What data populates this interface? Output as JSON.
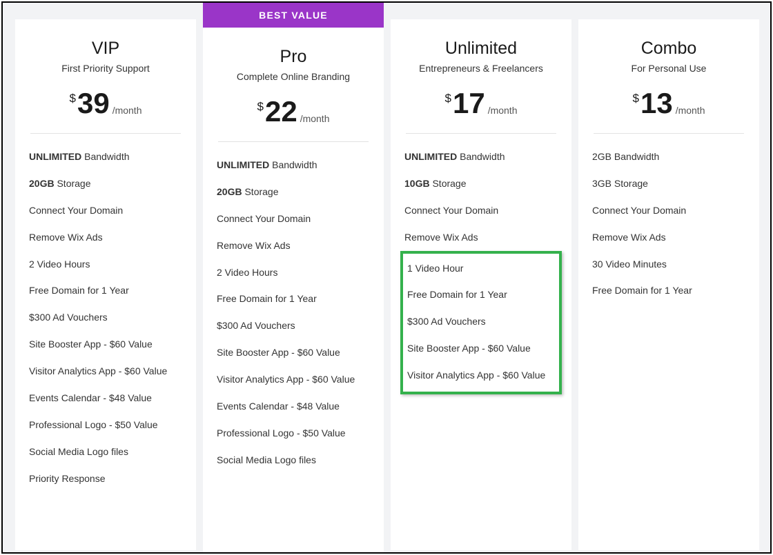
{
  "best_value_label": "BEST VALUE",
  "currency_symbol": "$",
  "period_label": "/month",
  "plans": [
    {
      "title": "VIP",
      "subtitle": "First Priority Support",
      "price": "39",
      "features": [
        {
          "prefix": "UNLIMITED",
          "text": "Bandwidth"
        },
        {
          "prefix": "20GB",
          "text": "Storage"
        },
        {
          "text": "Connect Your Domain"
        },
        {
          "text": "Remove Wix Ads"
        },
        {
          "text": "2 Video Hours"
        },
        {
          "text": "Free Domain for 1 Year"
        },
        {
          "text": "$300 Ad Vouchers"
        },
        {
          "text": "Site Booster App - $60 Value"
        },
        {
          "text": "Visitor Analytics App - $60 Value"
        },
        {
          "text": "Events Calendar - $48 Value"
        },
        {
          "text": "Professional Logo - $50 Value"
        },
        {
          "text": "Social Media Logo files"
        },
        {
          "text": "Priority Response"
        }
      ]
    },
    {
      "title": "Pro",
      "subtitle": "Complete Online Branding",
      "price": "22",
      "best_value": true,
      "features": [
        {
          "prefix": "UNLIMITED",
          "text": "Bandwidth"
        },
        {
          "prefix": "20GB",
          "text": "Storage"
        },
        {
          "text": "Connect Your Domain"
        },
        {
          "text": "Remove Wix Ads"
        },
        {
          "text": "2 Video Hours"
        },
        {
          "text": "Free Domain for 1 Year"
        },
        {
          "text": "$300 Ad Vouchers"
        },
        {
          "text": "Site Booster App - $60 Value"
        },
        {
          "text": "Visitor Analytics App - $60 Value"
        },
        {
          "text": "Events Calendar - $48 Value"
        },
        {
          "text": "Professional Logo - $50 Value"
        },
        {
          "text": "Social Media Logo files"
        }
      ]
    },
    {
      "title": "Unlimited",
      "subtitle": "Entrepreneurs & Freelancers",
      "price": "17",
      "highlight_start": 4,
      "highlight_end": 8,
      "features": [
        {
          "prefix": "UNLIMITED",
          "text": "Bandwidth"
        },
        {
          "prefix": "10GB",
          "text": "Storage"
        },
        {
          "text": "Connect Your Domain"
        },
        {
          "text": "Remove Wix Ads"
        },
        {
          "text": "1 Video Hour"
        },
        {
          "text": "Free Domain for 1 Year"
        },
        {
          "text": "$300 Ad Vouchers"
        },
        {
          "text": "Site Booster App - $60 Value"
        },
        {
          "text": "Visitor Analytics App - $60 Value"
        }
      ]
    },
    {
      "title": "Combo",
      "subtitle": "For Personal Use",
      "price": "13",
      "features": [
        {
          "text": "2GB Bandwidth"
        },
        {
          "text": "3GB Storage"
        },
        {
          "text": "Connect Your Domain"
        },
        {
          "text": "Remove Wix Ads"
        },
        {
          "text": "30 Video Minutes"
        },
        {
          "text": "Free Domain for 1 Year"
        }
      ]
    }
  ]
}
